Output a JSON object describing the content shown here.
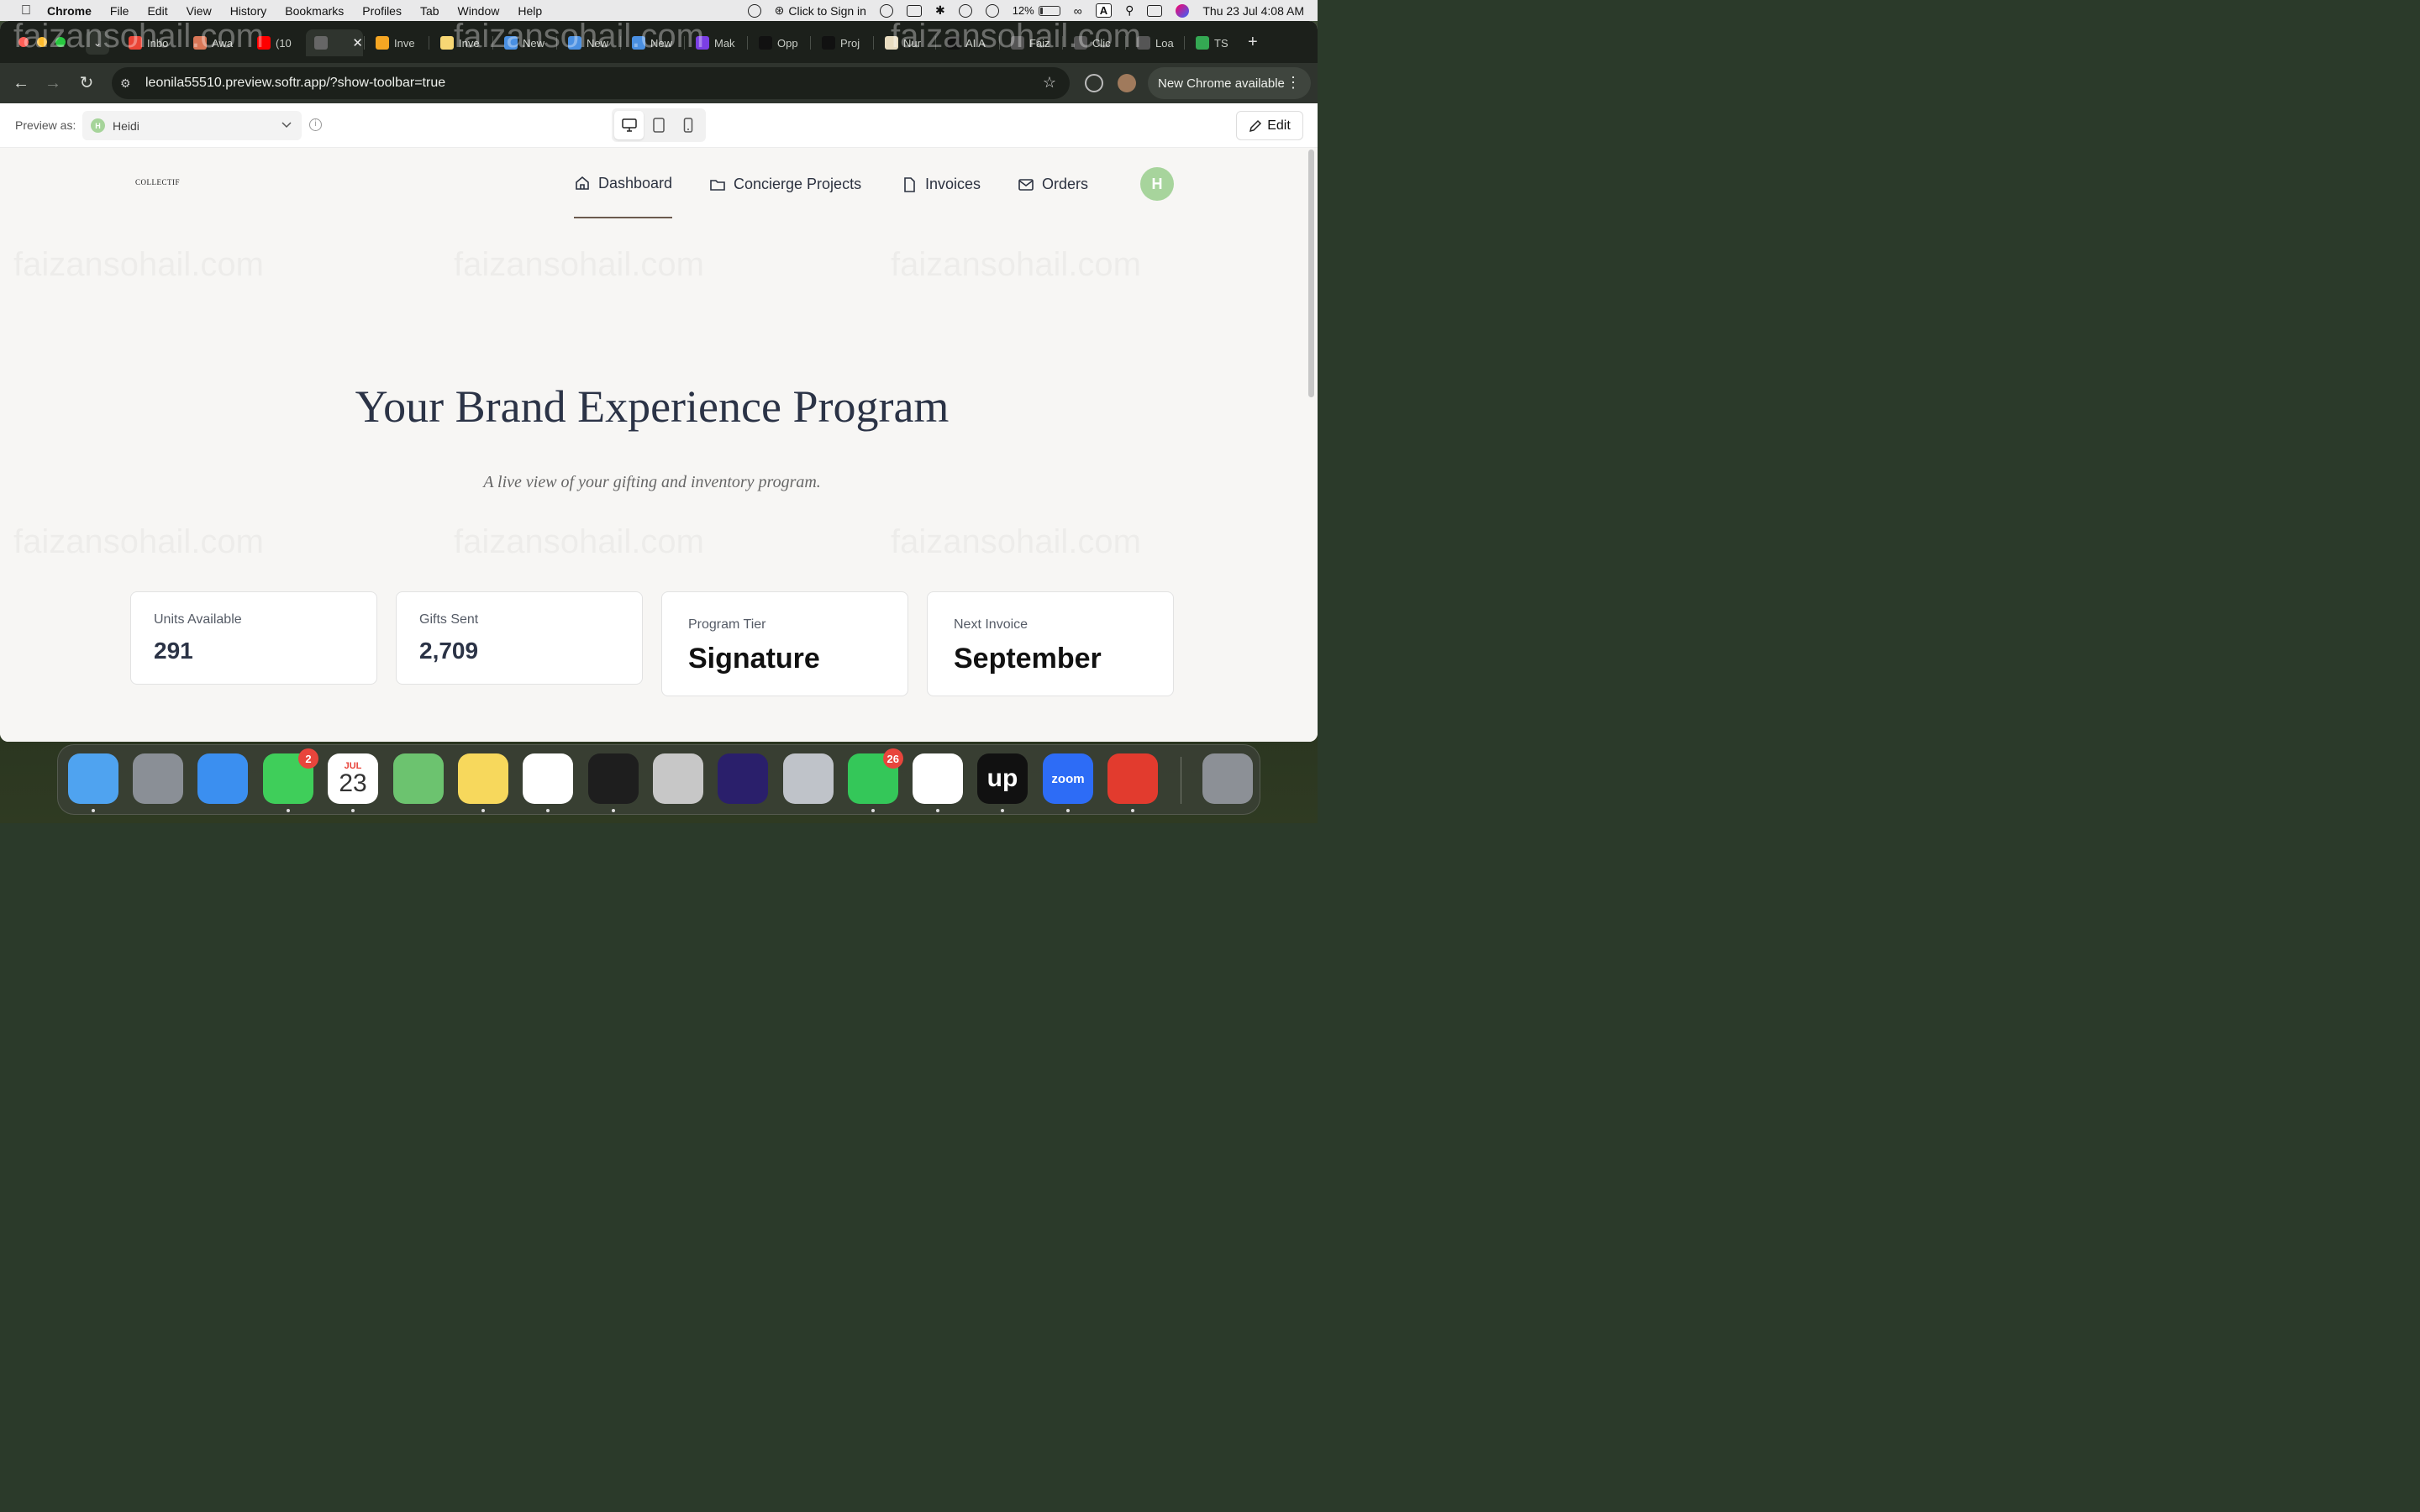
{
  "menubar": {
    "app_name": "Chrome",
    "menus": [
      "File",
      "Edit",
      "View",
      "History",
      "Bookmarks",
      "Profiles",
      "Tab",
      "Window",
      "Help"
    ],
    "sign_in": "Click to Sign in",
    "battery": "12%",
    "datetime": "Thu 23 Jul  4:08 AM"
  },
  "tabs": [
    {
      "label": "Inbo",
      "color": "#ea4335"
    },
    {
      "label": "Awa",
      "color": "#d97757"
    },
    {
      "label": "(10",
      "color": "#ff0000"
    },
    {
      "label": "",
      "color": "#666666"
    },
    {
      "label": "Inve",
      "color": "#f5a623"
    },
    {
      "label": "Inve",
      "color": "#f7d774"
    },
    {
      "label": "New",
      "color": "#4a90e2"
    },
    {
      "label": "New",
      "color": "#4a90e2"
    },
    {
      "label": "New",
      "color": "#4a90e2"
    },
    {
      "label": "Mak",
      "color": "#7b3fe4"
    },
    {
      "label": "Opp",
      "color": "#111111"
    },
    {
      "label": "Proj",
      "color": "#111111"
    },
    {
      "label": "Nur",
      "color": "#e8dcc0"
    },
    {
      "label": "AI A",
      "color": "#111111"
    },
    {
      "label": "Faiz",
      "color": "#555555"
    },
    {
      "label": "Clic",
      "color": "#555555"
    },
    {
      "label": "Loa",
      "color": "#555555"
    },
    {
      "label": "TS",
      "color": "#34a853"
    }
  ],
  "browser": {
    "url": "leonila55510.preview.softr.app/?show-toolbar=true",
    "chrome_update": "New Chrome available"
  },
  "preview_bar": {
    "label": "Preview as:",
    "user": "Heidi",
    "user_initial": "H",
    "edit": "Edit"
  },
  "site": {
    "logo": "COLLECTIF",
    "nav": [
      {
        "label": "Dashboard",
        "icon": "home-icon"
      },
      {
        "label": "Concierge Projects",
        "icon": "folder-icon"
      },
      {
        "label": "Invoices",
        "icon": "file-icon"
      },
      {
        "label": "Orders",
        "icon": "mail-icon"
      }
    ],
    "avatar_initial": "H"
  },
  "hero": {
    "title": "Your Brand Experience Program",
    "subtitle": "A live view of your gifting and inventory program."
  },
  "stats": [
    {
      "label": "Units Available",
      "value": "291"
    },
    {
      "label": "Gifts Sent",
      "value": "2,709"
    },
    {
      "label": "Program Tier",
      "value": "Signature"
    },
    {
      "label": "Next Invoice",
      "value": "September"
    }
  ],
  "watermark": "faizansohail.com",
  "dock": {
    "apps": [
      {
        "name": "Finder",
        "color": "#4fa3f0"
      },
      {
        "name": "Launchpad",
        "color": "#8a8f96"
      },
      {
        "name": "Mail",
        "color": "#3b8ff0"
      },
      {
        "name": "Messages",
        "color": "#3fce5a",
        "badge": "2"
      },
      {
        "name": "Calendar",
        "color": "#ffffff",
        "month": "JUL",
        "day": "23"
      },
      {
        "name": "Maps",
        "color": "#6cc36f"
      },
      {
        "name": "Notes",
        "color": "#f7d85c"
      },
      {
        "name": "Chrome",
        "color": "#ffffff"
      },
      {
        "name": "Spotify",
        "color": "#1e1e1e"
      },
      {
        "name": "Calculator",
        "color": "#c7c7c7"
      },
      {
        "name": "Firefox",
        "color": "#2a1f6b"
      },
      {
        "name": "iPhone Mirroring",
        "color": "#bfc3c9"
      },
      {
        "name": "WhatsApp",
        "color": "#34c759",
        "badge": "26"
      },
      {
        "name": "Slack",
        "color": "#ffffff"
      },
      {
        "name": "Upwork",
        "color": "#111111",
        "label": "up"
      },
      {
        "name": "Zoom",
        "color": "#2d6cf6",
        "label": "zoom"
      },
      {
        "name": "AnyDesk",
        "color": "#e23b2e"
      },
      {
        "name": "Trash",
        "color": "#8c9096"
      }
    ]
  }
}
